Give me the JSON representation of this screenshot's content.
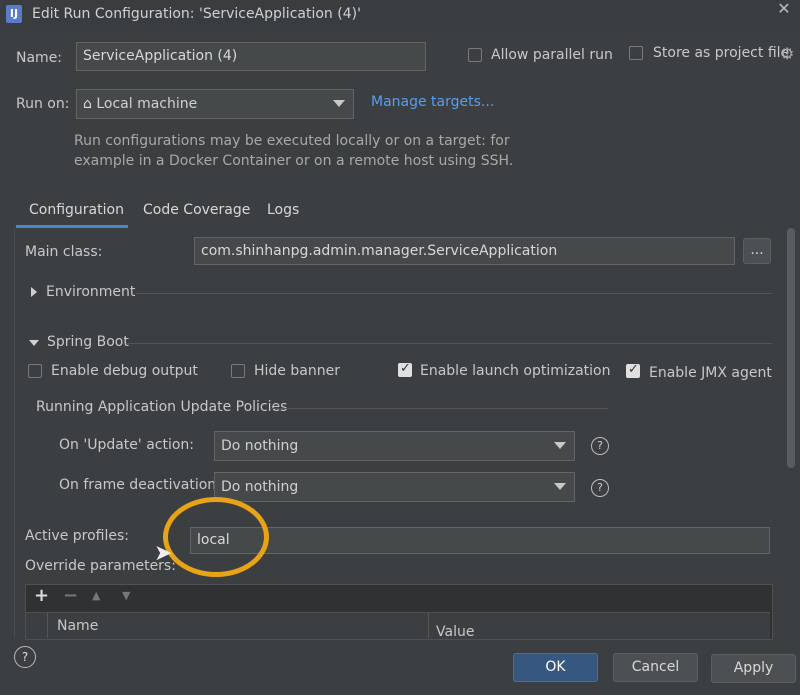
{
  "window": {
    "app_icon": "IJ",
    "title": "Edit Run Configuration: 'ServiceApplication (4)'"
  },
  "top": {
    "name_label": "Name:",
    "name_value": "ServiceApplication (4)",
    "allow_parallel_label": "Allow parallel run",
    "store_project_label": "Store as project file",
    "run_on_label": "Run on:",
    "run_on_value": "Local machine",
    "manage_targets": "Manage targets...",
    "hint_line1": "Run configurations may be executed locally or on a target: for",
    "hint_line2": "example in a Docker Container or on a remote host using SSH."
  },
  "tabs": [
    {
      "label": "Configuration",
      "active": true
    },
    {
      "label": "Code Coverage",
      "active": false
    },
    {
      "label": "Logs",
      "active": false
    }
  ],
  "config": {
    "main_class_label": "Main class:",
    "main_class_value": "com.shinhanpg.admin.manager.ServiceApplication",
    "browse_label": "...",
    "environment_label": "Environment",
    "spring_boot_label": "Spring Boot",
    "checkboxes": [
      {
        "label": "Enable debug output",
        "checked": false
      },
      {
        "label": "Hide banner",
        "checked": false
      },
      {
        "label": "Enable launch optimization",
        "checked": true
      },
      {
        "label": "Enable JMX agent",
        "checked": true
      }
    ],
    "policies_label": "Running Application Update Policies",
    "on_update_label": "On 'Update' action:",
    "on_update_value": "Do nothing",
    "on_frame_label": "On frame deactivation:",
    "on_frame_value": "Do nothing",
    "help_glyph": "?",
    "active_profiles_label": "Active profiles:",
    "active_profiles_value": "local",
    "override_label": "Override parameters:",
    "table_toolbar": {
      "add": "+",
      "remove": "−",
      "up": "▲",
      "down": "▼"
    },
    "table_columns": [
      "Name",
      "Value"
    ]
  },
  "footer": {
    "help_glyph": "?",
    "ok_label": "OK",
    "cancel_label": "Cancel",
    "apply_label": "Apply"
  },
  "colors": {
    "accent": "#4a88c7",
    "link": "#589df6",
    "annotation": "#e8a317"
  }
}
